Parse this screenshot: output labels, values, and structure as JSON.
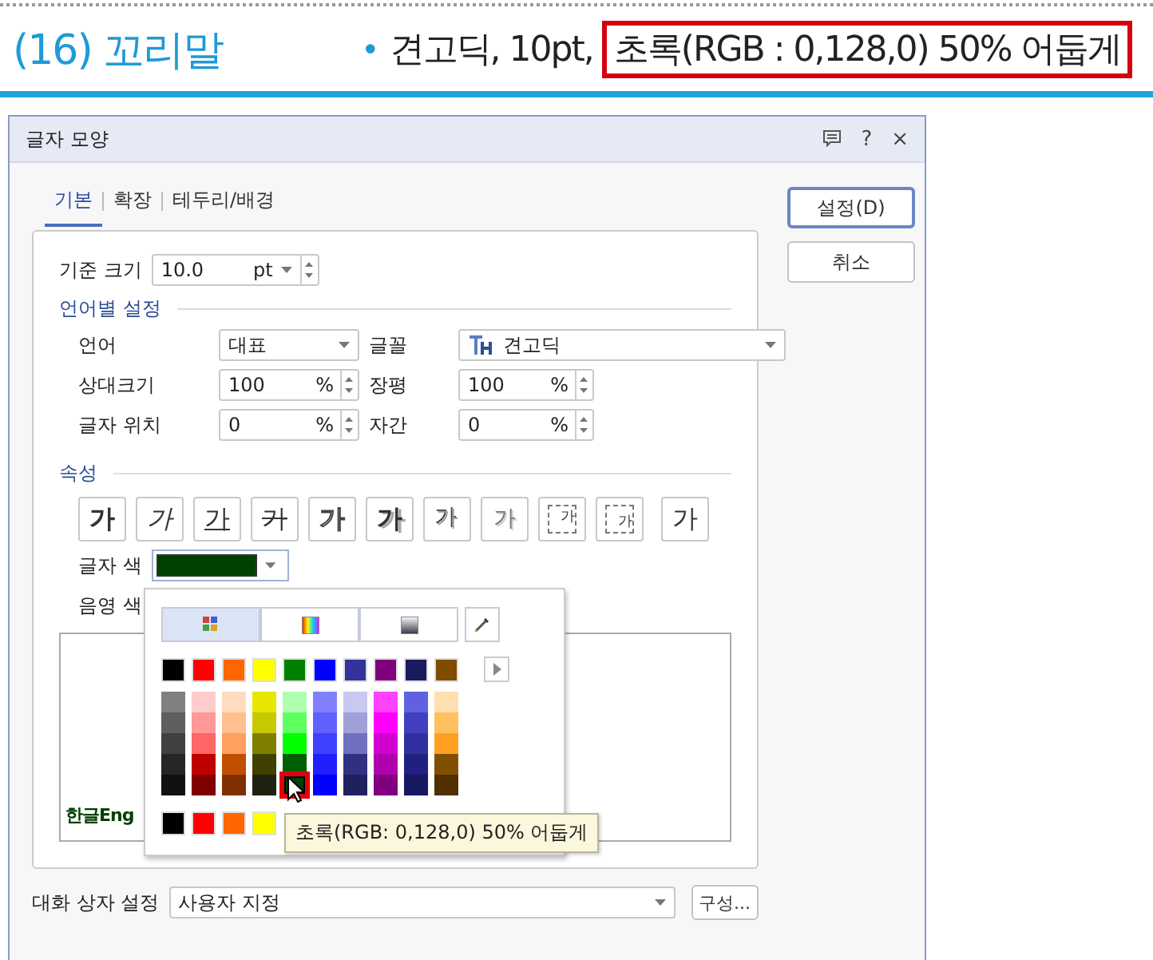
{
  "header": {
    "title": "(16) 꼬리말",
    "bullet": "•",
    "note": "견고딕, 10pt,",
    "highlight": "초록(RGB : 0,128,0) 50% 어둡게"
  },
  "dialog": {
    "title": "글자 모양",
    "help": "?",
    "close": "×",
    "tabs": [
      {
        "label": "기본",
        "selected": true
      },
      {
        "label": "확장",
        "selected": false
      },
      {
        "label": "테두리/배경",
        "selected": false
      }
    ],
    "buttons": [
      {
        "label": "설정(D)",
        "default": true
      },
      {
        "label": "취소",
        "default": false
      }
    ],
    "base_size": {
      "label": "기준 크기",
      "value": "10.0",
      "unit": "pt"
    },
    "language_section": "언어별 설정",
    "fields": [
      {
        "label": "언어",
        "value": "대표",
        "kind": "dropdown"
      },
      {
        "label": "글꼴",
        "value": "견고딕",
        "kind": "font"
      },
      {
        "label": "상대크기",
        "value": "100",
        "unit": "%",
        "kind": "spin"
      },
      {
        "label": "장평",
        "value": "100",
        "unit": "%",
        "kind": "spin"
      },
      {
        "label": "글자 위치",
        "value": "0",
        "unit": "%",
        "kind": "spin"
      },
      {
        "label": "자간",
        "value": "0",
        "unit": "%",
        "kind": "spin"
      }
    ],
    "attributes_section": "속성",
    "attributes": [
      {
        "label": "가",
        "kind": "bold"
      },
      {
        "label": "가",
        "kind": "italic"
      },
      {
        "label": "가",
        "kind": "underline"
      },
      {
        "label": "가",
        "kind": "strike"
      },
      {
        "label": "가",
        "kind": "outline"
      },
      {
        "label": "가",
        "kind": "shadow"
      },
      {
        "label": "가",
        "kind": "emboss"
      },
      {
        "label": "가",
        "kind": "engrave"
      },
      {
        "label": "가",
        "kind": "superscript"
      },
      {
        "label": "가",
        "kind": "subscript"
      },
      {
        "label": "가",
        "kind": "normal"
      }
    ],
    "text_color": {
      "label": "글자 색",
      "color": "#004000"
    },
    "shade_color": {
      "label": "음영 색"
    },
    "preview": {
      "text": "한글Eng"
    },
    "dialog_settings": {
      "label": "대화 상자 설정",
      "value": "사용자 지정",
      "button": "구성..."
    }
  },
  "picker": {
    "tabs": [
      {
        "kind": "grid",
        "selected": true
      },
      {
        "kind": "spectrum",
        "selected": false
      },
      {
        "kind": "gradient",
        "selected": false
      }
    ],
    "basic": [
      {
        "color": "#000000"
      },
      {
        "color": "#ff0000"
      },
      {
        "color": "#ff6600"
      },
      {
        "color": "#ffff00"
      },
      {
        "color": "#008000"
      },
      {
        "color": "#0000ff"
      },
      {
        "color": "#333399"
      },
      {
        "color": "#800080"
      },
      {
        "color": "#1a1a5e"
      },
      {
        "color": "#804c00"
      }
    ],
    "shades": [
      {
        "swatches": [
          {
            "color": "#808080",
            "selected": false
          },
          {
            "color": "#5f5f5f",
            "selected": false
          },
          {
            "color": "#404040",
            "selected": false
          },
          {
            "color": "#262626",
            "selected": false
          },
          {
            "color": "#111111",
            "selected": false
          }
        ]
      },
      {
        "swatches": [
          {
            "color": "#ffcccc",
            "selected": false
          },
          {
            "color": "#ff9999",
            "selected": false
          },
          {
            "color": "#ff6666",
            "selected": false
          },
          {
            "color": "#c00000",
            "selected": false
          },
          {
            "color": "#800000",
            "selected": false
          }
        ]
      },
      {
        "swatches": [
          {
            "color": "#ffdcc0",
            "selected": false
          },
          {
            "color": "#ffc090",
            "selected": false
          },
          {
            "color": "#ff9f60",
            "selected": false
          },
          {
            "color": "#c05000",
            "selected": false
          },
          {
            "color": "#803000",
            "selected": false
          }
        ]
      },
      {
        "swatches": [
          {
            "color": "#e6e600",
            "selected": false
          },
          {
            "color": "#c8c800",
            "selected": false
          },
          {
            "color": "#808000",
            "selected": false
          },
          {
            "color": "#404000",
            "selected": false
          },
          {
            "color": "#202010",
            "selected": false
          }
        ]
      },
      {
        "swatches": [
          {
            "color": "#b0ffb0",
            "selected": false
          },
          {
            "color": "#60ff60",
            "selected": false
          },
          {
            "color": "#00ff00",
            "selected": false
          },
          {
            "color": "#006000",
            "selected": false
          },
          {
            "color": "#004000",
            "selected": true
          }
        ]
      },
      {
        "swatches": [
          {
            "color": "#8080ff",
            "selected": false
          },
          {
            "color": "#6060ff",
            "selected": false
          },
          {
            "color": "#4040ff",
            "selected": false
          },
          {
            "color": "#2020ff",
            "selected": false
          },
          {
            "color": "#0000ff",
            "selected": false
          }
        ]
      },
      {
        "swatches": [
          {
            "color": "#c8c8f0",
            "selected": false
          },
          {
            "color": "#a0a0d8",
            "selected": false
          },
          {
            "color": "#7070c0",
            "selected": false
          },
          {
            "color": "#303080",
            "selected": false
          },
          {
            "color": "#202060",
            "selected": false
          }
        ]
      },
      {
        "swatches": [
          {
            "color": "#ff40ff",
            "selected": false
          },
          {
            "color": "#ff00ff",
            "selected": false
          },
          {
            "color": "#d000d0",
            "selected": false
          },
          {
            "color": "#b000b0",
            "selected": false
          },
          {
            "color": "#800080",
            "selected": false
          }
        ]
      },
      {
        "swatches": [
          {
            "color": "#6060e0",
            "selected": false
          },
          {
            "color": "#4040c0",
            "selected": false
          },
          {
            "color": "#3030a0",
            "selected": false
          },
          {
            "color": "#202080",
            "selected": false
          },
          {
            "color": "#181860",
            "selected": false
          }
        ]
      },
      {
        "swatches": [
          {
            "color": "#ffe0b0",
            "selected": false
          },
          {
            "color": "#ffc060",
            "selected": false
          },
          {
            "color": "#ffa020",
            "selected": false
          },
          {
            "color": "#805000",
            "selected": false
          },
          {
            "color": "#503000",
            "selected": false
          }
        ]
      }
    ],
    "recent": [
      {
        "color": "#000000"
      },
      {
        "color": "#ff0000"
      },
      {
        "color": "#ff6600"
      },
      {
        "color": "#ffff00"
      }
    ],
    "tooltip": "초록(RGB: 0,128,0) 50% 어둡게"
  }
}
